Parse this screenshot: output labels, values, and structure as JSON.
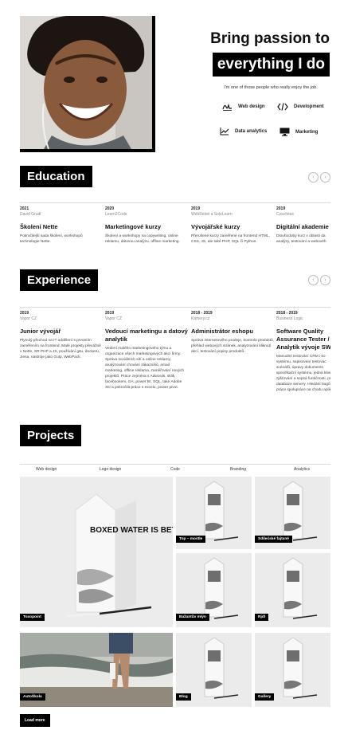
{
  "hero": {
    "title_line1": "Bring passion to",
    "title_line2": "everything I do",
    "tagline": "I'm one of those people who really enjoy the job.",
    "skills": [
      {
        "icon": "signature-icon",
        "label": "Web design"
      },
      {
        "icon": "code-icon",
        "label": "Development"
      },
      {
        "icon": "chart-icon",
        "label": "Data analytics"
      },
      {
        "icon": "monitor-icon",
        "label": "Marketing"
      }
    ]
  },
  "education": {
    "heading": "Education",
    "items": [
      {
        "year": "2021",
        "org": "David Grudl",
        "title": "Školení Nette",
        "desc": "Pokročilejší sada školení, workshopů technologie Nette."
      },
      {
        "year": "2020",
        "org": "Learn2Code",
        "title": "Marketingové kurzy",
        "desc": "Školení a workshopy na copywriting, online reklamu, datovou analýzu, offline marketing."
      },
      {
        "year": "2019",
        "org": "WebRebel a SoloLearn",
        "title": "Vývojářské kurzy",
        "desc": "Přerušené kurzy zaměřené na frontend HTML, CSS, JS, ale také PHP, SQL či Python."
      },
      {
        "year": "2019",
        "org": "Czechitas",
        "title": "Digitální akademie",
        "desc": "Dlouhodobý kurz v oblasti da analýzy, testování a webovéh"
      }
    ]
  },
  "experience": {
    "heading": "Experience",
    "items": [
      {
        "year": "2019",
        "org": "Vapor CZ",
        "title": "Junior vývojář",
        "desc": "Plynulý přechod na IT oddělení s prvotním zaměřením na frontend. Malé projekty převážně v Nette, SR PHP a JS, používání gitu, dockeru, Jiesa, nástroje jako Gulp, WebPack."
      },
      {
        "year": "2019",
        "org": "Vapor CZ",
        "title": "Vedoucí marketingu a datový analytik",
        "desc": "Vedení malého marketingového týmu a organizace všech marketingových akcí firmy. Správa sociálních sítí a online reklamy, analýzování chování zákazníků, email marketing, offline reklama, zaměřování nových projektů. Práce zejména s Adwords, sklik, facebookem, GA, power BI, SQL, také Adobe XD a pokročilá práce s excelu, power pivot."
      },
      {
        "year": "2018 - 2019",
        "org": "Kamery.cz",
        "title": "Administrátor eshopu",
        "desc": "Správa internetového prodeje, kontrola produktů, přehled webových stránek, analyzování kliknutí akcí, testování popisy produktů."
      },
      {
        "year": "2018 - 2019",
        "org": "Business Logic",
        "title": "Software Quality Assurance Tester / Analytik vývoje SW",
        "desc": "Manuální testování CRM i ko systému, sepisování testovac scénářů, úpravy dokumento specifikační systému, jedná klientem, zjišťování a sepsá funkčnosti, práce s databáze servery. Hledání bugů, práce spolupráce na chodu aplikac"
      }
    ]
  },
  "projects": {
    "heading": "Projects",
    "tabs": [
      "Web design",
      "Logo design",
      "Code",
      "Branding",
      "Analytics"
    ],
    "tiles": [
      "Toxopoint",
      "Top – mostle",
      "Sdílečské fajtaně",
      "Bažantův mlýn",
      "Rjdl",
      "AutoŠkola",
      "Blog",
      "Gallery"
    ],
    "carton_text": "BOXED WATER IS BETTER.",
    "load_more": "Load more"
  }
}
